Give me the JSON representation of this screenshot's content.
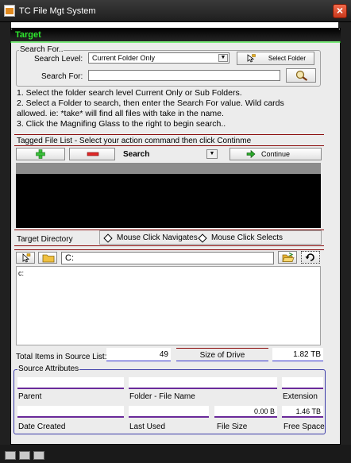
{
  "window": {
    "title": "TC File Mgt System",
    "close": "×",
    "icon": "notepad-icon"
  },
  "panel": {
    "title": "Target"
  },
  "search": {
    "legend": "Search For..",
    "level_label": "Search Level:",
    "level_value": "Current Folder Only",
    "select_folder_label": "Select Folder",
    "for_label": "Search For:",
    "for_value": ""
  },
  "instructions": [
    "1. Select the folder search level Current Only or Sub Folders.",
    "2. Select a Folder to search, then enter the Search For value. Wild cards",
    "allowed. ie: *take* will find all files with take in the name.",
    "3. Click the Magnifing Glass to the right to begin search.."
  ],
  "tagged": {
    "label": "Tagged File List - Select your action command then click Continme",
    "action_value": "Search",
    "continue_label": "Continue"
  },
  "target_dir": {
    "label": "Target Directory",
    "option_navigates": "Mouse Click Navigates",
    "option_selects": "Mouse Click Selects",
    "path_value": "C:",
    "items": [
      "c:"
    ]
  },
  "totals": {
    "items_label": "Total Items in Source List:",
    "items_value": "49",
    "size_label": "Size of Drive",
    "size_value": "1.82 TB"
  },
  "attributes": {
    "legend": "Source Attributes",
    "parent_label": "Parent",
    "filename_label": "Folder - File Name",
    "extension_label": "Extension",
    "created_label": "Date Created",
    "lastused_label": "Last Used",
    "filesize_label": "File Size",
    "filesize_value": "0.00 B",
    "freespace_label": "Free Space",
    "freespace_value": "1.46 TB"
  },
  "colors": {
    "accent_green": "#2ee82e",
    "rule_red": "#8a0a0a",
    "rule_blue": "#3333cc",
    "field_purple": "#6a2a9a"
  }
}
